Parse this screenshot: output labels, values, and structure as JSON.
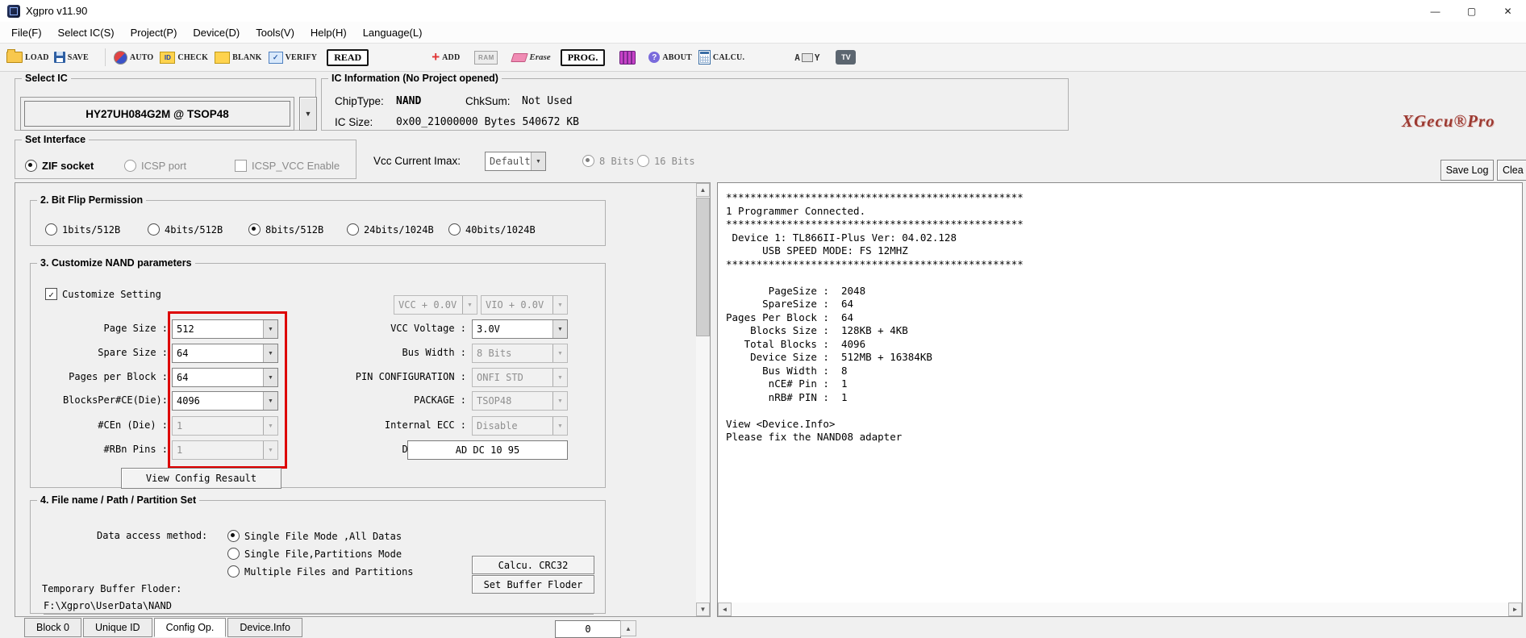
{
  "window": {
    "title": "Xgpro v11.90",
    "minimize": "—",
    "maximize": "▢",
    "close": "✕"
  },
  "menu": {
    "items": [
      {
        "label": "File(F)"
      },
      {
        "label": "Select IC(S)"
      },
      {
        "label": "Project(P)"
      },
      {
        "label": "Device(D)"
      },
      {
        "label": "Tools(V)"
      },
      {
        "label": "Help(H)"
      },
      {
        "label": "Language(L)"
      }
    ]
  },
  "toolbar": {
    "load": "LOAD",
    "save": "SAVE",
    "auto": "AUTO",
    "check": "CHECK",
    "check_icon": "ID",
    "blank": "BLANK",
    "verify": "VERIFY",
    "read": "READ",
    "add": "ADD",
    "ram": "RAM",
    "erase": "Erase",
    "prog": "PROG.",
    "about": "ABOUT",
    "calcu": "CALCU.",
    "ay_a": "A",
    "ay_y": "Y",
    "tv": "TV"
  },
  "select_ic": {
    "legend": "Select IC",
    "value": "HY27UH084G2M @ TSOP48"
  },
  "ic_info": {
    "legend": "IC Information (No Project opened)",
    "chip_type_label": "ChipType:",
    "chip_type": "NAND",
    "chksum_label": "ChkSum:",
    "chksum": "Not Used",
    "ic_size_label": "IC Size:",
    "ic_size": "0x00_21000000 Bytes 540672 KB"
  },
  "brand": "XGecu®Pro",
  "set_interface": {
    "legend": "Set Interface",
    "zif": "ZIF socket",
    "icsp": "ICSP port",
    "icsp_vcc": "ICSP_VCC Enable"
  },
  "vcc_row": {
    "label": "Vcc Current Imax:",
    "value": "Default",
    "bits8": "8 Bits",
    "bits16": "16 Bits"
  },
  "log_controls": {
    "save_log": "Save Log",
    "clear": "Clea"
  },
  "bit_flip": {
    "legend": "2. Bit Flip Permission",
    "options": [
      "1bits/512B",
      "4bits/512B",
      "8bits/512B",
      "24bits/1024B",
      "40bits/1024B"
    ]
  },
  "nand": {
    "legend": "3. Customize NAND parameters",
    "customize": "Customize Setting",
    "left_rows": [
      {
        "label": "Page Size :",
        "value": "512"
      },
      {
        "label": "Spare Size :",
        "value": "64"
      },
      {
        "label": "Pages per Block :",
        "value": "64"
      },
      {
        "label": "BlocksPer#CE(Die):",
        "value": "4096"
      },
      {
        "label": "#CEn (Die) :",
        "value": "1"
      },
      {
        "label": "#RBn Pins :",
        "value": "1"
      }
    ],
    "vcc_offset": "VCC + 0.0V",
    "vio_offset": "VIO + 0.0V",
    "right_rows": [
      {
        "label": "VCC Voltage :",
        "value": "3.0V"
      },
      {
        "label": "Bus Width :",
        "value": "8 Bits"
      },
      {
        "label": "PIN CONFIGURATION :",
        "value": "ONFI STD"
      },
      {
        "label": "PACKAGE :",
        "value": "TSOP48"
      },
      {
        "label": "Internal ECC :",
        "value": "Disable"
      }
    ],
    "device_id_label": "Device ID :",
    "device_id": "AD DC 10 95",
    "view_config": "View Config Resault"
  },
  "file_set": {
    "legend": "4. File name / Path / Partition Set",
    "data_access_label": "Data access method:",
    "modes": [
      "Single File Mode ,All Datas",
      "Single File,Partitions Mode",
      "Multiple Files and Partitions"
    ],
    "calc_crc": "Calcu. CRC32",
    "set_buffer": "Set Buffer Floder",
    "temp_label": "Temporary Buffer Floder:",
    "temp_path": "F:\\Xgpro\\UserData\\NAND"
  },
  "log": {
    "text": "*************************************************\n1 Programmer Connected.\n*************************************************\n Device 1: TL866II-Plus Ver: 04.02.128\n      USB SPEED MODE: FS 12MHZ\n*************************************************\n\n       PageSize :  2048\n      SpareSize :  64\nPages Per Block :  64\n    Blocks Size :  128KB + 4KB\n   Total Blocks :  4096\n    Device Size :  512MB + 16384KB\n      Bus Width :  8\n       nCE# Pin :  1\n       nRB# PIN :  1\n\nView <Device.Info>\nPlease fix the NAND08 adapter"
  },
  "tabs": [
    {
      "label": "Block 0"
    },
    {
      "label": "Unique ID"
    },
    {
      "label": "Config Op."
    },
    {
      "label": "Device.Info"
    }
  ],
  "spinner": {
    "value": "0"
  }
}
